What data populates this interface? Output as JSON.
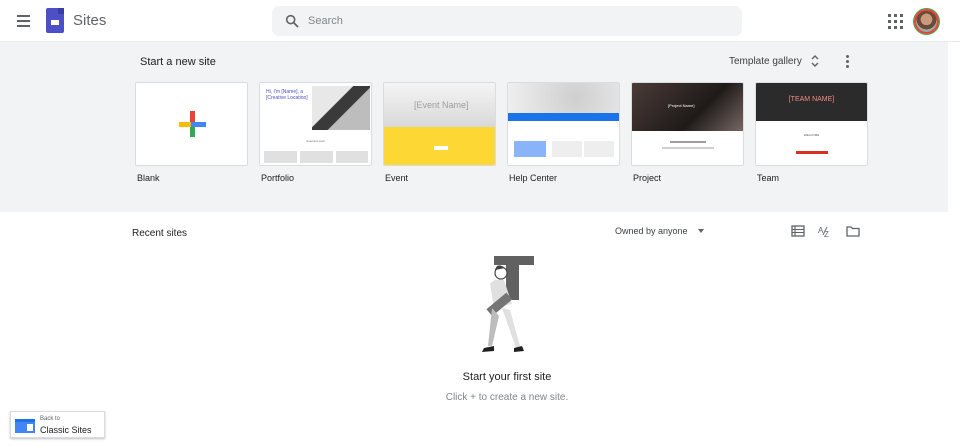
{
  "header": {
    "app_title": "Sites",
    "search_placeholder": "Search"
  },
  "templates": {
    "section_title": "Start a new site",
    "gallery_label": "Template gallery",
    "cards": [
      {
        "label": "Blank"
      },
      {
        "label": "Portfolio",
        "thumb_text": "Hi, I'm [Name], a [Creative Location]",
        "thumb_sub": "Selected work"
      },
      {
        "label": "Event",
        "thumb_text": "[Event Name]"
      },
      {
        "label": "Help Center"
      },
      {
        "label": "Project",
        "thumb_text": "[Project Name]"
      },
      {
        "label": "Team",
        "thumb_text": "[TEAM NAME]",
        "thumb_sub": "WELCOME"
      }
    ]
  },
  "recent": {
    "section_title": "Recent sites",
    "owner_filter": "Owned by anyone",
    "empty_title": "Start your first site",
    "empty_subtitle": "Click + to create a new site."
  },
  "classic": {
    "small": "Back to",
    "big": "Classic Sites"
  },
  "colors": {
    "accent": "#4d4fc5",
    "event_yellow": "#fdd835",
    "help_blue": "#1a73e8",
    "team_red": "#d93025"
  }
}
